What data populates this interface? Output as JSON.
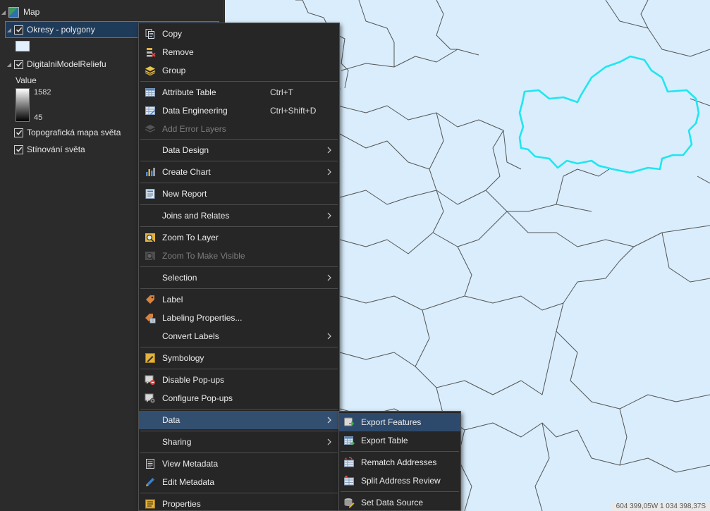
{
  "contents": {
    "map_label": "Map",
    "layers": [
      {
        "label": "Okresy - polygony",
        "checked": true,
        "selected": true
      },
      {
        "label": "DigitalniModelReliefu",
        "checked": true
      },
      {
        "label": "Topografická mapa světa",
        "checked": true
      },
      {
        "label": "Stínování světa",
        "checked": true
      }
    ],
    "legend": {
      "title": "Value",
      "high": "1582",
      "low": "45"
    }
  },
  "context_menu": {
    "items": [
      {
        "label": "Copy",
        "icon": "copy-icon"
      },
      {
        "label": "Remove",
        "icon": "remove-icon"
      },
      {
        "label": "Group",
        "icon": "group-layers-icon"
      },
      {
        "label": "Attribute Table",
        "shortcut": "Ctrl+T",
        "icon": "attribute-table-icon"
      },
      {
        "label": "Data Engineering",
        "shortcut": "Ctrl+Shift+D",
        "icon": "data-engineering-icon"
      },
      {
        "label": "Add Error Layers",
        "disabled": true,
        "icon": "add-error-layers-icon"
      },
      {
        "label": "Data Design",
        "submenu": true
      },
      {
        "label": "Create Chart",
        "submenu": true,
        "icon": "chart-icon"
      },
      {
        "label": "New Report",
        "icon": "report-icon"
      },
      {
        "label": "Joins and Relates",
        "submenu": true
      },
      {
        "label": "Zoom To Layer",
        "icon": "zoom-to-layer-icon"
      },
      {
        "label": "Zoom To Make Visible",
        "disabled": true,
        "icon": "zoom-make-visible-icon"
      },
      {
        "label": "Selection",
        "submenu": true
      },
      {
        "label": "Label",
        "icon": "label-icon"
      },
      {
        "label": "Labeling Properties...",
        "icon": "labeling-properties-icon"
      },
      {
        "label": "Convert Labels",
        "submenu": true
      },
      {
        "label": "Symbology",
        "icon": "symbology-icon"
      },
      {
        "label": "Disable Pop-ups",
        "icon": "disable-popups-icon"
      },
      {
        "label": "Configure Pop-ups",
        "icon": "configure-popups-icon"
      },
      {
        "label": "Data",
        "submenu": true,
        "highlighted": true
      },
      {
        "label": "Sharing",
        "submenu": true
      },
      {
        "label": "View Metadata",
        "icon": "view-metadata-icon"
      },
      {
        "label": "Edit Metadata",
        "icon": "edit-metadata-icon"
      },
      {
        "label": "Properties",
        "icon": "properties-icon"
      }
    ]
  },
  "data_submenu": {
    "items": [
      {
        "label": "Export Features",
        "highlighted": true,
        "icon": "export-features-icon"
      },
      {
        "label": "Export Table",
        "icon": "export-table-icon"
      },
      {
        "label": "Rematch Addresses",
        "icon": "rematch-addresses-icon"
      },
      {
        "label": "Split Address Review",
        "icon": "split-address-review-icon"
      },
      {
        "label": "Set Data Source",
        "icon": "set-data-source-icon"
      }
    ]
  },
  "map": {
    "background": "#d9edfc",
    "boundary_color": "#555555",
    "selection_color": "#1fe6f0",
    "coordinates": "604 399,05W 1 034 398,37S"
  },
  "colors": {
    "menu_bg": "#262626",
    "highlight": "#334f70",
    "selected_layer": "#1f3b5a"
  }
}
